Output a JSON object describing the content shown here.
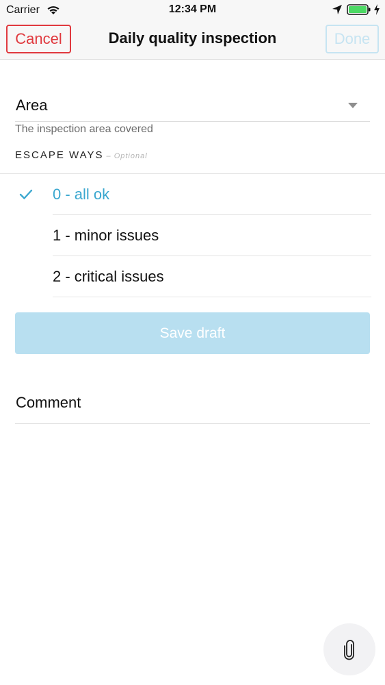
{
  "status_bar": {
    "carrier": "Carrier",
    "time": "12:34 PM",
    "icons": [
      "wifi-icon",
      "location-icon",
      "battery-icon",
      "charging-icon"
    ],
    "battery_level": 1.0,
    "battery_color": "#4cd964"
  },
  "nav": {
    "cancel_label": "Cancel",
    "title": "Daily quality inspection",
    "done_label": "Done"
  },
  "form": {
    "area": {
      "label": "Area",
      "helper": "The inspection area covered",
      "icon": "chevron-down-icon"
    },
    "escape_ways": {
      "header": "ESCAPE WAYS",
      "optional_label": "– Optional",
      "options": [
        {
          "label": "0 - all ok",
          "selected": true
        },
        {
          "label": "1 - minor issues",
          "selected": false
        },
        {
          "label": "2 - critical issues",
          "selected": false
        }
      ]
    },
    "save_draft_label": "Save draft",
    "comment": {
      "label": "Comment"
    }
  },
  "fab": {
    "icon": "paperclip-icon"
  },
  "colors": {
    "accent": "#3aa7cf",
    "cancel": "#e0393e",
    "done_disabled": "#c6e4f2",
    "save_disabled": "#b8dff0"
  }
}
